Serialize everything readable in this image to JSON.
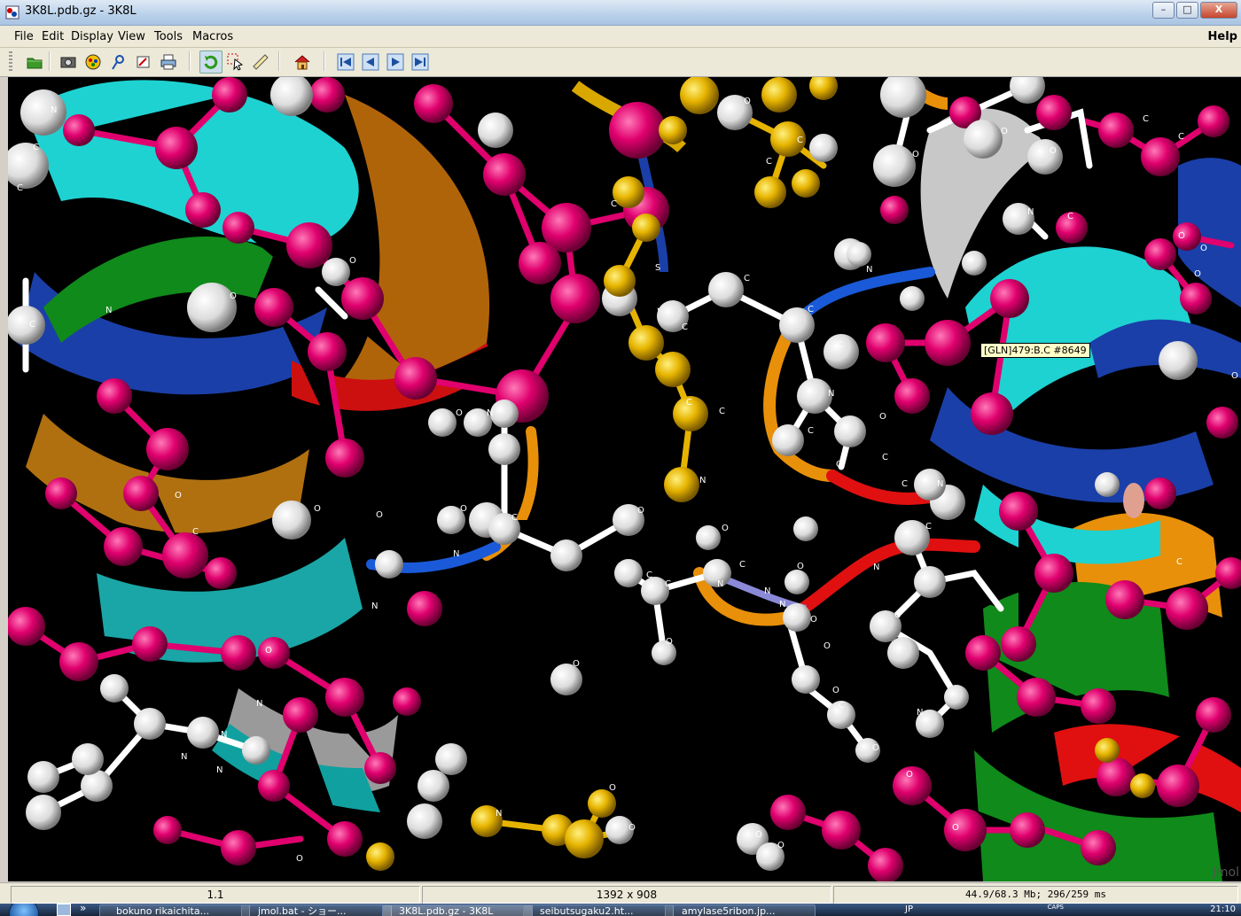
{
  "window": {
    "title": "3K8L.pdb.gz - 3K8L",
    "buttons": {
      "minimize": "–",
      "maximize": "□",
      "close": "X"
    }
  },
  "menubar": {
    "items": [
      {
        "label": "File"
      },
      {
        "label": "Edit"
      },
      {
        "label": "Display"
      },
      {
        "label": "View"
      },
      {
        "label": "Tools"
      },
      {
        "label": "Macros"
      }
    ],
    "help": "Help"
  },
  "toolbar": {
    "buttons": [
      {
        "icon": "open-folder-icon"
      },
      {
        "icon": "camera-icon"
      },
      {
        "icon": "preferences-icon"
      },
      {
        "icon": "edit-script-icon"
      },
      {
        "icon": "export-icon"
      },
      {
        "icon": "print-icon"
      },
      {
        "icon": "rotate-icon"
      },
      {
        "icon": "pick-icon"
      },
      {
        "icon": "measure-icon"
      },
      {
        "icon": "home-icon"
      },
      {
        "icon": "first-frame-icon"
      },
      {
        "icon": "prev-frame-icon"
      },
      {
        "icon": "next-frame-icon"
      },
      {
        "icon": "last-frame-icon"
      }
    ]
  },
  "viewer": {
    "hover_label": "[GLN]479:B.C #8649",
    "watermark": "Jmol",
    "background": "#000000",
    "colors": {
      "magenta_atoms": "#e0006e",
      "white_atoms": "#f0f0f0",
      "yellow_atoms": "#e6b400",
      "cyan_ribbon": "#1ed2d2",
      "blue_ribbon": "#1a3fa8",
      "orange_ribbon": "#e8900a",
      "green_ribbon": "#108a1a",
      "red_ribbon": "#e01010",
      "gray_ribbon": "#b8b8b8"
    }
  },
  "statusbar": {
    "frame": "1.1",
    "size": "1392 x 908",
    "memory": "44.9/68.3 Mb; 296/259 ms"
  },
  "taskbar": {
    "tasks": [
      {
        "label": "bokuno rikaichita..."
      },
      {
        "label": "jmol.bat - ショー..."
      },
      {
        "label": "3K8L.pdb.gz - 3K8L"
      },
      {
        "label": "seibutsugaku2.ht..."
      },
      {
        "label": "amylase5ribon.jp..."
      }
    ],
    "ime": "JP",
    "caps": "CAPS",
    "clock": "21:10"
  }
}
